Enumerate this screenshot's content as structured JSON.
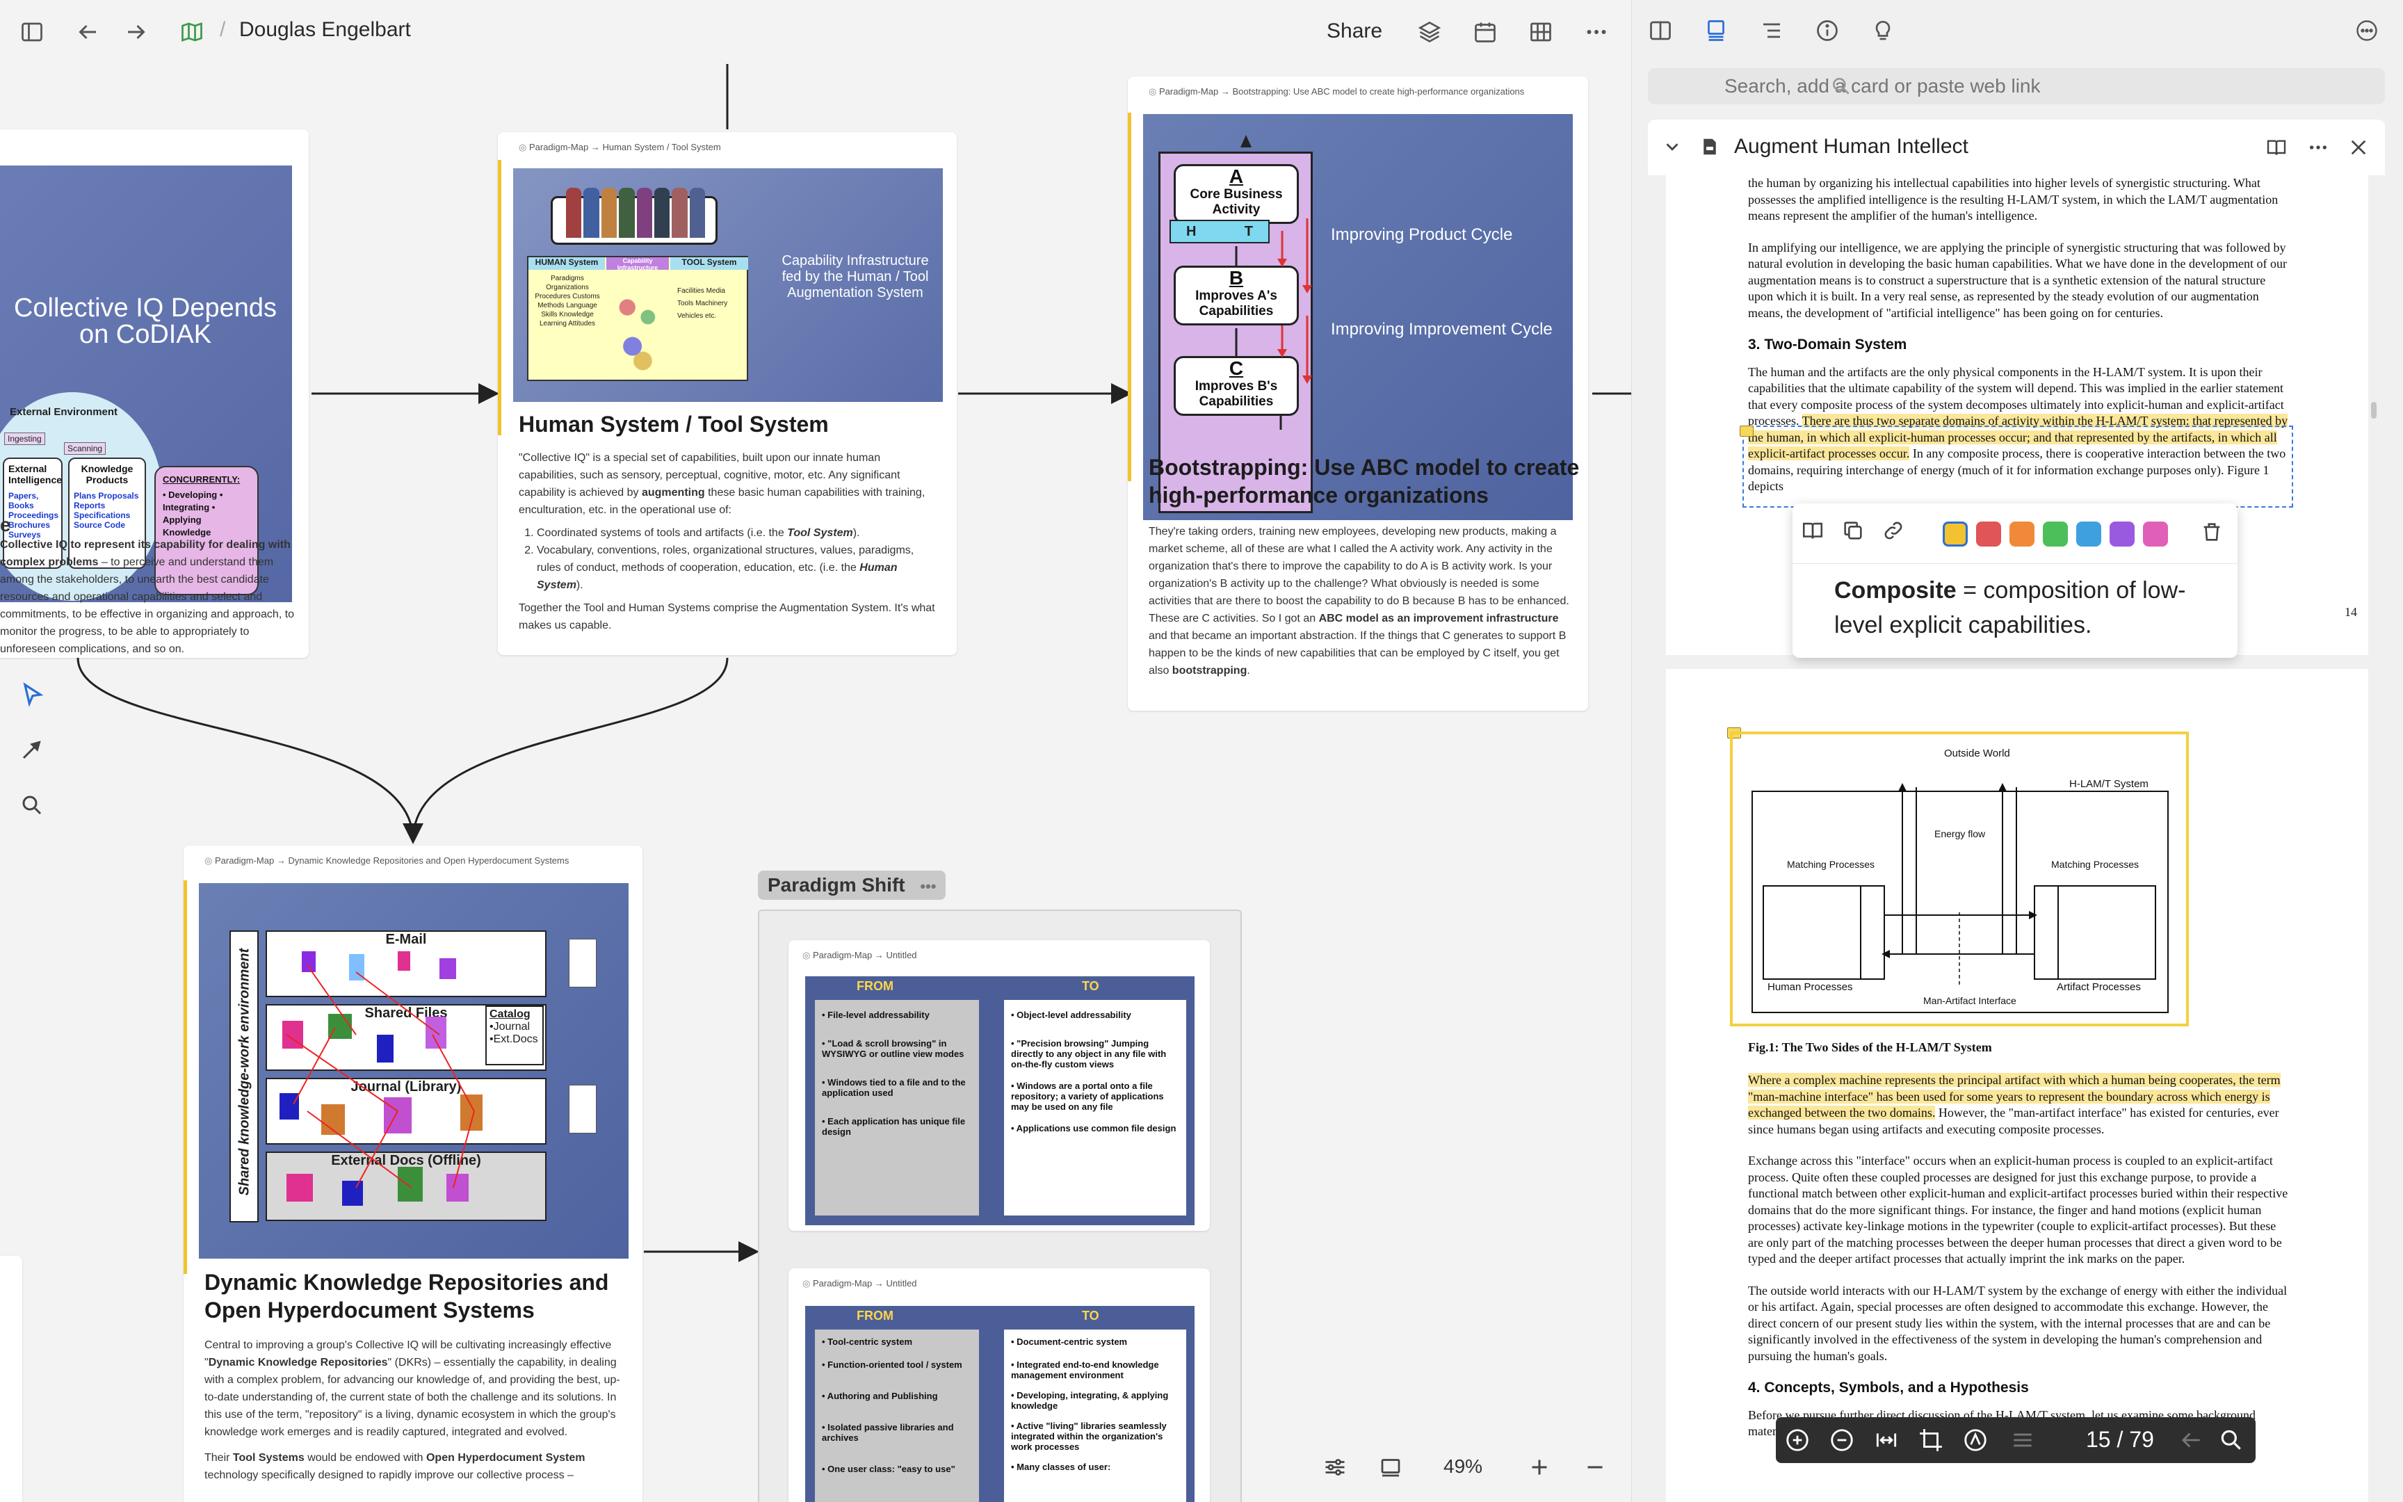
{
  "topbar": {
    "title": "Douglas Engelbart",
    "separator": "/",
    "share_label": "Share"
  },
  "cards": {
    "iq": {
      "slide_title": "Collective IQ Depends on CoDIAK",
      "slide_env": "External Environment",
      "slide_ingesting": "Ingesting",
      "slide_scanning": "Scanning",
      "slide_external": "External Intelligence",
      "slide_ext_items": "Papers, Books Proceedings Brochures Surveys",
      "slide_knowledge": "Knowledge Products",
      "slide_kp_items": "Plans Proposals Reports Specifications Source Code",
      "slide_concurrently": "CONCURRENTLY:",
      "slide_conc_items": "• Developing • Integrating • Applying Knowledge",
      "body_lead": "Collective IQ to ",
      "body_bold": "represent its capability for dealing with complex problems",
      "body_rest": " – to perceive and understand them among the stakeholders, to unearth the best candidate resources and operational capabilities and select and commitments, to be effective in organizing and approach, to monitor the progress, to be able to appropriately to unforeseen complications, and so on."
    },
    "hsts": {
      "crumb": "Paradigm-Map → Human System / Tool System",
      "slide_caption": "Capability Infrastructure fed by the Human / Tool Augmentation System",
      "slide_human": "HUMAN System",
      "slide_tool": "TOOL System",
      "slide_cap": "Capability Infrastructure",
      "slide_human_items": "Paradigms Organizations Procedures Customs Methods Language Skills Knowledge Learning Attitudes",
      "slide_tool_items": "Facilities Media Tools Machinery Vehicles etc.",
      "title": "Human System / Tool System",
      "p1_a": "\"Collective IQ\" is a special set of capabilities, built upon our innate human capabilities, such as sensory, perceptual, cognitive, motor, etc. Any significant capability is achieved by ",
      "p1_b": "augmenting",
      "p1_c": " these basic human capabilities with training, enculturation, etc. in the operational use of:",
      "li1_a": "Coordinated systems of tools and artifacts (i.e. the ",
      "li1_b": "Tool System",
      "li1_c": ").",
      "li2_a": "Vocabulary, conventions, roles, organizational structures, values, paradigms, rules of conduct, methods of cooperation, education, etc. (i.e. the ",
      "li2_b": "Human System",
      "li2_c": ").",
      "p2": "Together the Tool and Human Systems comprise the Augmentation System. It's what makes us capable."
    },
    "abc": {
      "crumb": "Paradigm-Map → Bootstrapping: Use ABC model to create high-performance organizations",
      "box_a_letter": "A",
      "box_a": "Core Business Activity",
      "h_label": "H",
      "t_label": "T",
      "box_b_letter": "B",
      "box_b": "Improves A's Capabilities",
      "box_c_letter": "C",
      "box_c": "Improves B's Capabilities",
      "cap1": "Improving Product Cycle",
      "cap2": "Improving Improvement Cycle",
      "title": "Bootstrapping: Use ABC model to create high-performance organizations",
      "p_a": "They're taking orders, training new employees, developing new products, making a market scheme, all of these are what I called the A activity work. Any activity in the organization that's there to improve the capability to do A is B activity work. Is your organization's B activity up to the challenge? What obviously is needed is some activities that are there to boost the capability to do B because B has to be enhanced. These are C activities. So I got an ",
      "p_b": "ABC model as an improvement infrastructure",
      "p_c": " and that became an important abstraction. If the things that C generates to support B happen to be the kinds of new capabilities that can be employed by C itself, you get also ",
      "p_d": "bootstrapping",
      "p_e": "."
    },
    "dkr": {
      "crumb": "Paradigm-Map → Dynamic Knowledge Repositories and Open Hyperdocument Systems",
      "slide_side": "Shared knowledge-work environment",
      "slide_email": "E-Mail",
      "slide_shared": "Shared Files",
      "slide_journal": "Journal (Library)",
      "slide_external": "External Docs (Offline)",
      "slide_catalog": "Catalog",
      "slide_catalog_items": "•Journal •Ext.Docs",
      "title": "Dynamic Knowledge Repositories and Open Hyperdocument Systems",
      "p1_a": "Central to improving a group's Collective IQ will be cultivating increasingly effective \"",
      "p1_b": "Dynamic Knowledge Repositories",
      "p1_c": "\" (DKRs) – essentially the capability, in dealing with a complex problem, for advancing our knowledge of, and providing the best, up-to-date understanding of, the current state of both the challenge and its solutions. In this use of the term, \"repository\" is a living, dynamic ecosystem in which the group's knowledge work emerges and is readily captured, integrated and evolved.",
      "p2_a": "Their ",
      "p2_b": "Tool Systems",
      "p2_c": " would be endowed with ",
      "p2_d": "Open Hyperdocument System",
      "p2_e": " technology specifically designed to rapidly improve our collective process –"
    },
    "ps1": {
      "crumb": "Paradigm-Map → Untitled",
      "from": "FROM",
      "to": "TO",
      "from_items": [
        "• File-level addressability",
        "• \"Load & scroll browsing\" in WYSIWYG or outline view modes",
        "• Windows tied to a file and to the application used",
        "• Each application has unique file design"
      ],
      "to_items": [
        "• Object-level addressability",
        "• \"Precision browsing\" Jumping directly to any object in any file with on-the-fly custom views",
        "• Windows are a portal onto a file repository; a variety of applications may be used on any file",
        "• Applications use common file design"
      ]
    },
    "ps2": {
      "crumb": "Paradigm-Map → Untitled",
      "from": "FROM",
      "to": "TO",
      "from_items": [
        "• Tool-centric system",
        "• Function-oriented tool / system",
        "• Authoring and Publishing",
        "• Isolated passive libraries and archives",
        "• One user class: \"easy to use\""
      ],
      "to_items": [
        "• Document-centric system",
        "• Integrated end-to-end knowledge management environment",
        "• Developing, integrating, & applying knowledge",
        "• Active \"living\" libraries seamlessly integrated within the organization's work processes",
        "• Many classes of user:"
      ]
    }
  },
  "group": {
    "label": "Paradigm Shift",
    "more": "•••"
  },
  "canvas_toolbar": {
    "zoom": "49%"
  },
  "right_panel": {
    "search_placeholder": "Search, add a card or paste web link",
    "doc_title": "Augment Human Intellect",
    "page_indicator": "15 / 79",
    "page_number": "14",
    "p_top1": "the human by organizing his intellectual capabilities into higher levels of synergistic structuring. What possesses the amplified intelligence is the resulting H-LAM/T system, in which the LAM/T augmentation means represent the amplifier of the human's intelligence.",
    "p_top2": "In amplifying our intelligence, we are applying the principle of synergistic structuring that was followed by natural evolution in developing the basic human capabilities. What we have done in the development of our augmentation means is to construct a superstructure that is a synthetic extension of the natural structure upon which it is built. In a very real sense, as represented by the steady evolution of our augmentation means, the development of \"artificial intelligence\" has been going on for centuries.",
    "h_two_domain": "3. Two-Domain System",
    "p_td_a": "The human and the artifacts are the only physical components in the H-LAM/T system. It is upon their capabilities that the ultimate capability of the system will depend. This was implied in the earlier statement that every composite process of the system decomposes ultimately into explicit-human and explicit-artifact processes. ",
    "p_td_hl": "There are thus two separate domains of activity within the H-LAM/T system: that represented by the human, in which all explicit-human processes occur; and that represented by the artifacts, in which all explicit-artifact processes occur.",
    "p_td_b": " In any composite process, there is cooperative interaction between the two domains, requiring interchange of energy (much of it for information exchange purposes only). Figure 1 depicts",
    "popup_note_bold": "Composite",
    "popup_note_rest": " = composition of low-level explicit capabilities.",
    "fig": {
      "outside_world": "Outside World",
      "system": "H-LAM/T System",
      "energy_flow": "Energy flow",
      "matching_left": "Matching Processes",
      "matching_right": "Matching Processes",
      "human_processes": "Human Processes",
      "artifact_processes": "Artifact Processes",
      "interface": "Man-Artifact Interface",
      "caption": "Fig.1: The Two Sides of the H-LAM/T System"
    },
    "p_fig_hl": "Where a complex machine represents the principal artifact with which a human being cooperates, the term \"man-machine interface\" has been used for some years to represent the boundary across which energy is exchanged between the two domains.",
    "p_fig_b": " However, the \"man-artifact interface\" has existed for centuries, ever since humans began using artifacts and executing composite processes.",
    "p_exchange": "Exchange across this \"interface\" occurs when an explicit-human process is coupled to an explicit-artifact process. Quite often these coupled processes are designed for just this exchange purpose, to provide a functional match between other explicit-human and explicit-artifact processes buried within their respective domains that do the more significant things. For instance, the finger and hand motions (explicit human processes) activate key-linkage motions in the typewriter (couple to explicit-artifact processes). But these are only part of the matching processes between the deeper human processes that direct a given word to be typed and the deeper artifact processes that actually imprint the ink marks on the paper.",
    "p_outside": "The outside world interacts with our H-LAM/T system by the exchange of energy with either the individual or his artifact. Again, special processes are often designed to accommodate this exchange. However, the direct concern of our present study lies within the system, with the internal processes that are and can be significantly involved in the effectiveness of the system in developing the human's comprehension and pursuing the human's goals.",
    "h_four": "4. Concepts, Symbols, and a Hypothesis",
    "p_before": "Before we pursue further direct discussion of the H-LAM/T system, let us examine some background material. Consider the following historical progression in the development of our"
  },
  "colors": {
    "accent": "#f2c230",
    "highlight": "#fbe79a",
    "swatches": [
      "#f2c230",
      "#e05555",
      "#f08a3a",
      "#4cbf5a",
      "#3fa0e0",
      "#9a5ae0",
      "#e060b8"
    ]
  }
}
